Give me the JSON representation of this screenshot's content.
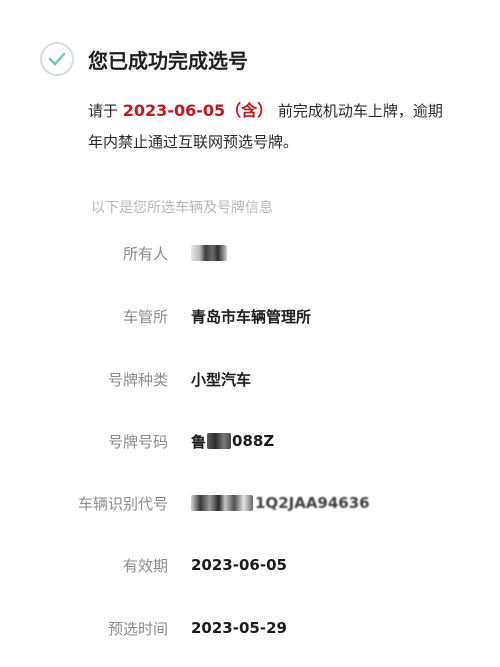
{
  "header": {
    "title": "您已成功完成选号"
  },
  "notice": {
    "prefix": "请于 ",
    "date": "2023-06-05（含）",
    "suffix": " 前完成机动车上牌，逾期",
    "line2": "年内禁止通过互联网预选号牌。"
  },
  "section_title": "以下是您所选车辆及号牌信息",
  "info": {
    "owner": {
      "label": "所有人",
      "value": ""
    },
    "office": {
      "label": "车管所",
      "value": "青岛市车辆管理所"
    },
    "plate_type": {
      "label": "号牌种类",
      "value": "小型汽车"
    },
    "plate_number": {
      "label": "号牌号码",
      "value_prefix": "鲁",
      "value_suffix": "088Z"
    },
    "vin": {
      "label": "车辆识别代号",
      "value": "1Q2JAA94636"
    },
    "validity": {
      "label": "有效期",
      "value": "2023-06-05"
    },
    "selection_time": {
      "label": "预选时间",
      "value": "2023-05-29"
    }
  },
  "colors": {
    "accent_red": "#c2171f",
    "check_green": "#7ec8a5",
    "label_gray": "#8c8c8c"
  }
}
